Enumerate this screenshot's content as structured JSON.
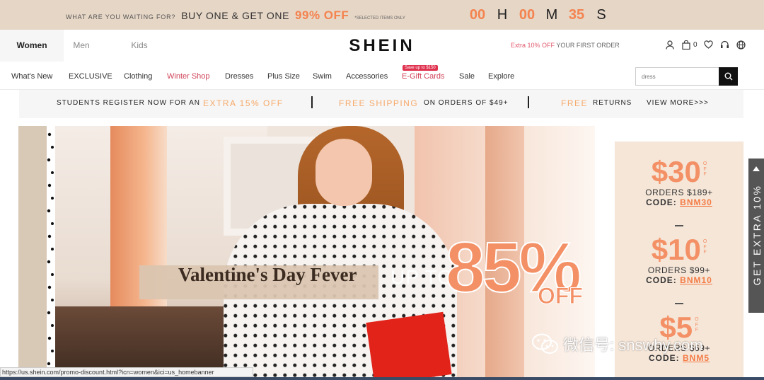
{
  "promo": {
    "small": "WHAT ARE YOU WAITING FOR?",
    "big": "BUY ONE & GET ONE",
    "off": "99% OFF",
    "note": "*SELECTED ITEMS ONLY",
    "countdown": [
      {
        "value": "00",
        "unit": "H"
      },
      {
        "value": "00",
        "unit": "M"
      },
      {
        "value": "35",
        "unit": "S"
      }
    ]
  },
  "header": {
    "tabs": [
      "Women",
      "Men",
      "Kids"
    ],
    "logo": "SHEIN",
    "first_order_highlight": "Extra 10% OFF",
    "first_order_rest": " YOUR FIRST ORDER",
    "bag_count": "0"
  },
  "nav": {
    "items": [
      "What's New",
      "EXCLUSIVE",
      "Clothing",
      "Winter Shop",
      "Dresses",
      "Plus Size",
      "Swim",
      "Accessories",
      "E-Gift Cards",
      "Sale",
      "Explore"
    ],
    "gift_badge": "Save up to $150",
    "search_placeholder": "dress"
  },
  "info_strip": {
    "students": "STUDENTS REGISTER NOW FOR AN",
    "extra": "EXTRA 15% OFF",
    "free_shipping": "FREE SHIPPING",
    "orders": "ON ORDERS OF $49+",
    "free": "FREE",
    "returns": "RETURNS",
    "view_more": "VIEW MORE>>>"
  },
  "banner": {
    "title": "Valentine's Day Fever",
    "up_to": "UP TO",
    "percent": "85%",
    "off": "OFF"
  },
  "coupons": [
    {
      "amount": "$30",
      "off_top": "O",
      "off_mid": "F",
      "off_bot": "F",
      "orders": "ORDERS $189+",
      "code_label": "CODE:",
      "code": "BNM30"
    },
    {
      "amount": "$10",
      "off_top": "O",
      "off_mid": "F",
      "off_bot": "F",
      "orders": "ORDERS $99+",
      "code_label": "CODE:",
      "code": "BNM10"
    },
    {
      "amount": "$5",
      "off_top": "O",
      "off_mid": "F",
      "off_bot": "F",
      "orders": "ORDERS $69+",
      "code_label": "CODE:",
      "code": "BNM5"
    }
  ],
  "extra_tab": "GET EXTRA 10%",
  "watermark": "微信号: snswhy.com",
  "status_url": "https://us.shein.com/promo-discount.html?icn=women&ici=us_homebanner",
  "colors": {
    "accent": "#f49065",
    "promo_bg": "#e6d6c6",
    "nav_red": "#d1455a"
  }
}
